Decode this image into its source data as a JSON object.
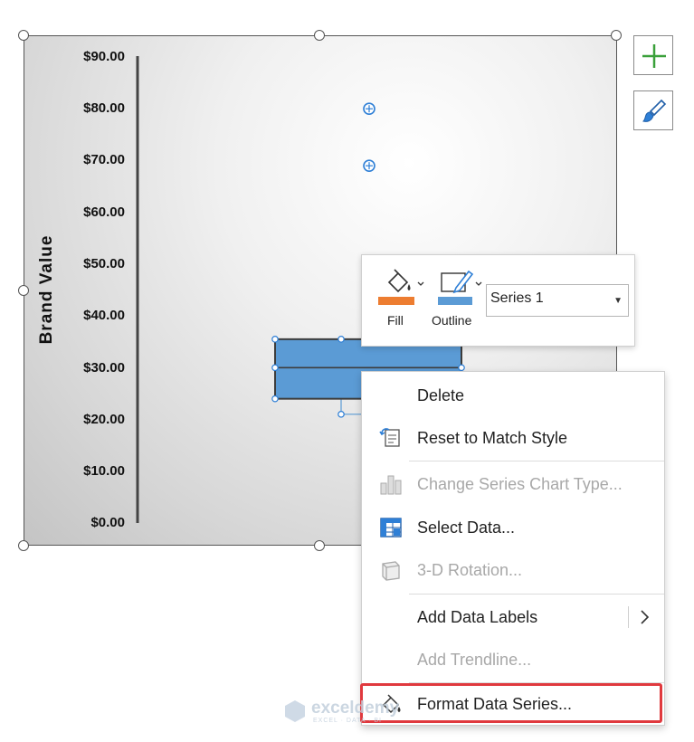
{
  "chart": {
    "y_axis_title": "Brand Value",
    "y_ticks": [
      "$90.00",
      "$80.00",
      "$70.00",
      "$60.00",
      "$50.00",
      "$40.00",
      "$30.00",
      "$20.00",
      "$10.00",
      "$0.00"
    ]
  },
  "chart_data": {
    "type": "box",
    "ylabel": "Brand Value",
    "ylim": [
      0,
      90
    ],
    "box": {
      "q1": 24,
      "median": 30,
      "q3": 35.5,
      "whisker_low": 21,
      "whisker_high": 36
    },
    "outliers": [
      80,
      69
    ]
  },
  "chart_buttons": {
    "add_element_icon": "plus-icon",
    "style_icon": "brush-icon"
  },
  "mini_toolbar": {
    "fill_label": "Fill",
    "outline_label": "Outline",
    "series_value": "Series 1",
    "fill_color": "#ED7D31",
    "outline_color": "#5B9BD5"
  },
  "context_menu": {
    "items": [
      {
        "label": "Delete",
        "enabled": true
      },
      {
        "label": "Reset to Match Style",
        "enabled": true
      },
      {
        "label": "Change Series Chart Type...",
        "enabled": false
      },
      {
        "label": "Select Data...",
        "enabled": true
      },
      {
        "label": "3-D Rotation...",
        "enabled": false
      },
      {
        "label": "Add Data Labels",
        "enabled": true
      },
      {
        "label": "Add Trendline...",
        "enabled": false
      },
      {
        "label": "Format Data Series...",
        "enabled": true
      }
    ]
  },
  "watermark": {
    "brand": "exceldemy",
    "tagline": "EXCEL · DATA · BI"
  },
  "colors": {
    "series_fill": "#5B9BD5",
    "highlight": "#E0393E"
  }
}
